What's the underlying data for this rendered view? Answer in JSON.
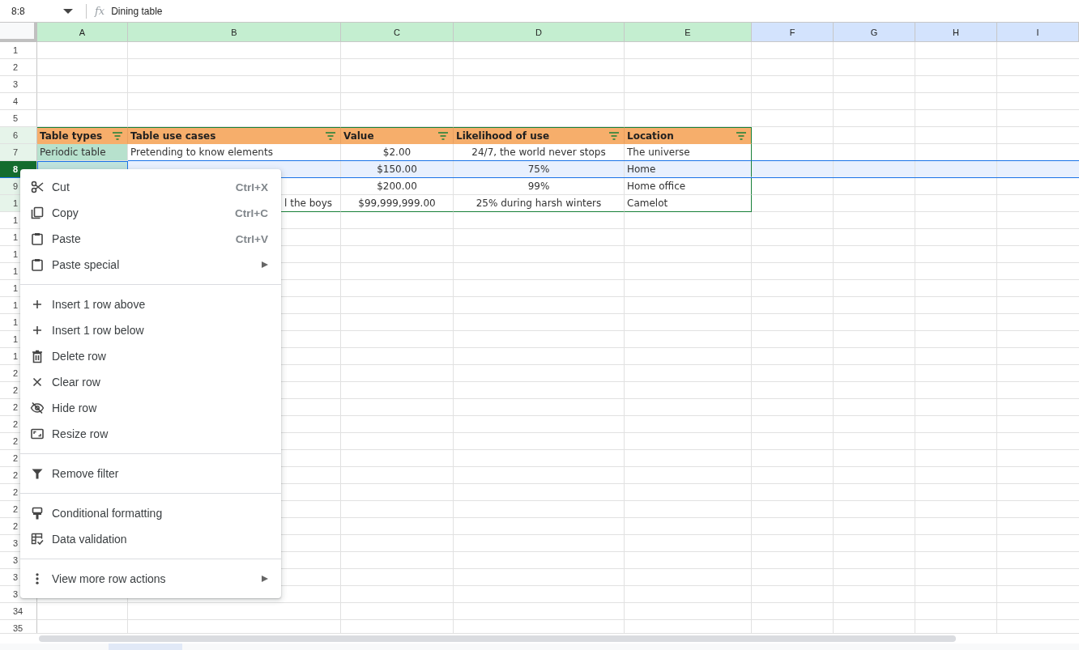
{
  "name_box": "8:8",
  "fx_label": "fx",
  "formula": "Dining table",
  "columns": [
    {
      "label": "A",
      "in_table": true
    },
    {
      "label": "B",
      "in_table": true
    },
    {
      "label": "C",
      "in_table": true
    },
    {
      "label": "D",
      "in_table": true
    },
    {
      "label": "E",
      "in_table": true
    },
    {
      "label": "F",
      "in_table": false
    },
    {
      "label": "G",
      "in_table": false
    },
    {
      "label": "H",
      "in_table": false
    },
    {
      "label": "I",
      "in_table": false
    }
  ],
  "rows": [
    {
      "label": "1",
      "selected": false
    },
    {
      "label": "2",
      "selected": false
    },
    {
      "label": "3",
      "selected": false
    },
    {
      "label": "4",
      "selected": false
    },
    {
      "label": "5",
      "selected": false
    },
    {
      "label": "6",
      "selected": false,
      "kind": "table_header",
      "cells": [
        {
          "text": "Table types"
        },
        {
          "text": "Table use cases"
        },
        {
          "text": "Value"
        },
        {
          "text": "Likelihood of use"
        },
        {
          "text": "Location"
        }
      ]
    },
    {
      "label": "7",
      "selected": false,
      "kind": "table_row",
      "cells": [
        {
          "text": "Periodic table",
          "highlighted": true
        },
        {
          "text": "Pretending to know elements"
        },
        {
          "text": "$2.00"
        },
        {
          "text": "24/7, the world never stops"
        },
        {
          "text": "The universe"
        }
      ]
    },
    {
      "label": "8",
      "selected": true,
      "kind": "table_row",
      "cells": [
        {
          "selected": true
        },
        null,
        {
          "text": "$150.00"
        },
        {
          "text": "75%"
        },
        {
          "text": "Home"
        }
      ]
    },
    {
      "label": "9",
      "selected": false,
      "kind": "table_row",
      "cells": [
        null,
        null,
        {
          "text": "$200.00"
        },
        {
          "text": "99%"
        },
        {
          "text": "Home office"
        }
      ]
    },
    {
      "label": "1",
      "selected": false,
      "kind": "table_row",
      "cells": [
        null,
        {
          "text": "l the boys",
          "kind": "partly_covered"
        },
        {
          "text": "$99,999,999.00"
        },
        {
          "text": "25% during harsh winters"
        },
        {
          "text": "Camelot"
        }
      ]
    },
    {
      "label": "1",
      "selected": false
    },
    {
      "label": "1",
      "selected": false
    },
    {
      "label": "1",
      "selected": false
    },
    {
      "label": "1",
      "selected": false
    },
    {
      "label": "1",
      "selected": false
    },
    {
      "label": "1",
      "selected": false
    },
    {
      "label": "1",
      "selected": false
    },
    {
      "label": "1",
      "selected": false
    },
    {
      "label": "1",
      "selected": false
    },
    {
      "label": "2",
      "selected": false
    },
    {
      "label": "2",
      "selected": false
    },
    {
      "label": "2",
      "selected": false
    },
    {
      "label": "2",
      "selected": false
    },
    {
      "label": "2",
      "selected": false
    },
    {
      "label": "2",
      "selected": false
    },
    {
      "label": "2",
      "selected": false
    },
    {
      "label": "2",
      "selected": false
    },
    {
      "label": "2",
      "selected": false
    },
    {
      "label": "2",
      "selected": false
    },
    {
      "label": "3",
      "selected": false
    },
    {
      "label": "3",
      "selected": false
    },
    {
      "label": "3",
      "selected": false
    },
    {
      "label": "3",
      "selected": false
    },
    {
      "label": "34",
      "selected": false
    },
    {
      "label": "35",
      "selected": false
    }
  ],
  "context_menu": {
    "groups": [
      [
        {
          "label": "Cut",
          "shortcut": "Ctrl+X",
          "kind": "cut"
        },
        {
          "label": "Copy",
          "shortcut": "Ctrl+C",
          "kind": "copy"
        },
        {
          "label": "Paste",
          "shortcut": "Ctrl+V",
          "kind": "paste"
        },
        {
          "label": "Paste special",
          "kind": "paste",
          "submenu": true
        }
      ],
      [
        {
          "label": "Insert 1 row above",
          "kind": "insert"
        },
        {
          "label": "Insert 1 row below",
          "kind": "insert"
        },
        {
          "label": "Delete row",
          "kind": "delete"
        },
        {
          "label": "Clear row",
          "kind": "clear"
        },
        {
          "label": "Hide row",
          "kind": "hide"
        },
        {
          "label": "Resize row",
          "kind": "resize"
        }
      ],
      [
        {
          "label": "Remove filter",
          "kind": "filter"
        }
      ],
      [
        {
          "label": "Conditional formatting",
          "kind": "format"
        },
        {
          "label": "Data validation",
          "kind": "validate"
        }
      ],
      [
        {
          "label": "View more row actions",
          "kind": "more",
          "submenu": true
        }
      ]
    ]
  }
}
